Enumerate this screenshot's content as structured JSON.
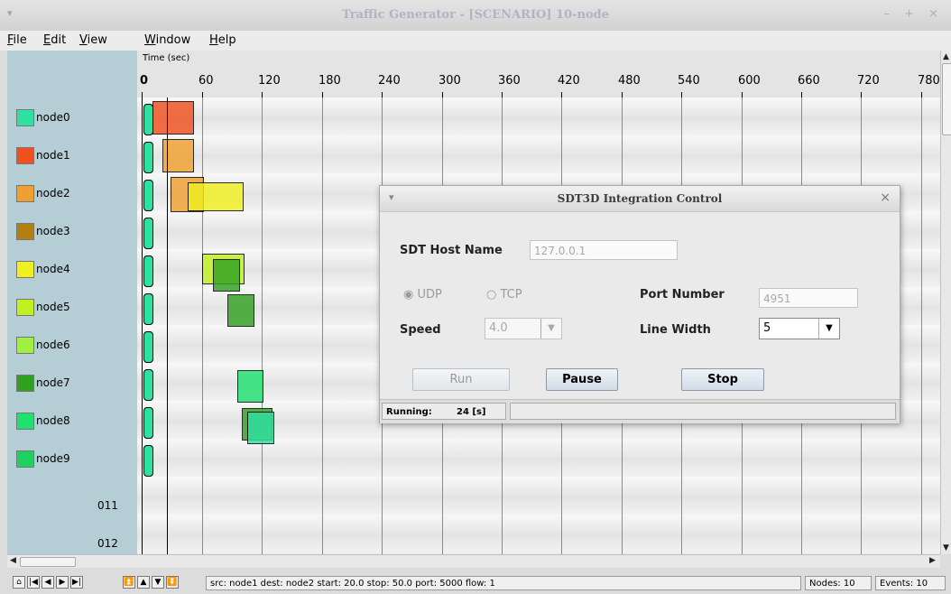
{
  "window": {
    "title": "Traffic Generator - [SCENARIO] 10-node",
    "menu_icon": "▾",
    "controls": "– + ×"
  },
  "menu": [
    "File",
    "Edit",
    "View",
    "Window",
    "Help"
  ],
  "axis": {
    "label": "Time (sec)",
    "ticks": [
      "0",
      "60",
      "120",
      "180",
      "240",
      "300",
      "360",
      "420",
      "480",
      "540",
      "600",
      "660",
      "720",
      "780"
    ]
  },
  "nodes": [
    {
      "name": "node0",
      "color": "#30e0a0"
    },
    {
      "name": "node1",
      "color": "#f05020"
    },
    {
      "name": "node2",
      "color": "#f0a030"
    },
    {
      "name": "node3",
      "color": "#b08010"
    },
    {
      "name": "node4",
      "color": "#f0f020"
    },
    {
      "name": "node5",
      "color": "#c0f020"
    },
    {
      "name": "node6",
      "color": "#a0f040"
    },
    {
      "name": "node7",
      "color": "#30a020"
    },
    {
      "name": "node8",
      "color": "#20e070"
    },
    {
      "name": "node9",
      "color": "#20d060"
    }
  ],
  "extra_rows": [
    "011",
    "012"
  ],
  "dialog": {
    "title": "SDT3D Integration Control",
    "close": "×",
    "menu_icon": "▾",
    "host_label": "SDT Host Name",
    "host_value": "127.0.0.1",
    "udp_label": "UDP",
    "tcp_label": "TCP",
    "port_label": "Port Number",
    "port_value": "4951",
    "speed_label": "Speed",
    "speed_value": "4.0",
    "linewidth_label": "Line Width",
    "linewidth_value": "5",
    "run_label": "Run",
    "pause_label": "Pause",
    "stop_label": "Stop",
    "status_label": "Running:",
    "status_value": "24 [s]"
  },
  "status": {
    "nav_icons": [
      "⌂",
      "|◀",
      "◀",
      "▶",
      "▶|",
      "⏫",
      "▲",
      "▼",
      "⏬"
    ],
    "info": "src: node1  dest: node2  start: 20.0  stop: 50.0  port: 5000  flow: 1",
    "nodes": "Nodes: 10",
    "events": "Events: 10"
  }
}
